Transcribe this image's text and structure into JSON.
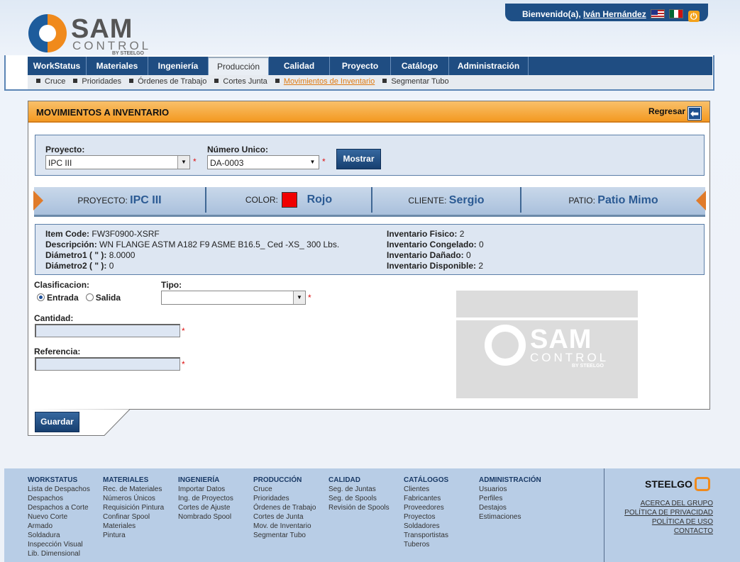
{
  "header": {
    "welcome_prefix": "Bienvenido(a),",
    "user_name": "Iván Hernández",
    "logo": {
      "brand": "SAM",
      "sub": "CONTROL",
      "by": "BY STEELGO"
    },
    "language_icons": [
      "us-flag-icon",
      "mx-flag-icon"
    ],
    "power_icon": "power-icon"
  },
  "nav": {
    "items": [
      "WorkStatus",
      "Materiales",
      "Ingeniería",
      "Producción",
      "Calidad",
      "Proyecto",
      "Catálogo",
      "Administración"
    ],
    "active": "Producción"
  },
  "subnav": {
    "items": [
      "Cruce",
      "Prioridades",
      "Órdenes de Trabajo",
      "Cortes Junta",
      "Movimientos de Inventario",
      "Segmentar Tubo"
    ],
    "active": "Movimientos de Inventario"
  },
  "panel": {
    "title": "MOVIMIENTOS A INVENTARIO",
    "back_label": "Regresar",
    "filters": {
      "proyecto_label": "Proyecto:",
      "proyecto_value": "IPC III",
      "numero_label": "Número Unico:",
      "numero_value": "DA-0003",
      "show_button": "Mostrar"
    },
    "band": {
      "proyecto_label": "PROYECTO:",
      "proyecto_value": "IPC III",
      "color_label": "COLOR:",
      "color_value": "Rojo",
      "color_hex": "#f00000",
      "cliente_label": "CLIENTE:",
      "cliente_value": "Sergio",
      "patio_label": "PATIO:",
      "patio_value": "Patio Mimo"
    },
    "details": {
      "item_code_label": "Item Code:",
      "item_code": "FW3F0900-XSRF",
      "descripcion_label": "Descripción:",
      "descripcion": "WN FLANGE ASTM A182 F9 ASME B16.5_ Ced -XS_ 300 Lbs.",
      "diametro1_label": "Diámetro1 ( \" ):",
      "diametro1": "8.0000",
      "diametro2_label": "Diámetro2 ( \" ):",
      "diametro2": "0",
      "inv_fisico_label": "Inventario Fisico:",
      "inv_fisico": "2",
      "inv_congelado_label": "Inventario Congelado:",
      "inv_congelado": "0",
      "inv_danado_label": "Inventario Dañado:",
      "inv_danado": "0",
      "inv_disponible_label": "Inventario Disponible:",
      "inv_disponible": "2"
    },
    "form": {
      "clasificacion_label": "Clasificacion:",
      "entrada_label": "Entrada",
      "salida_label": "Salida",
      "selected": "Entrada",
      "tipo_label": "Tipo:",
      "tipo_value": "",
      "cantidad_label": "Cantidad:",
      "cantidad_value": "",
      "referencia_label": "Referencia:",
      "referencia_value": "",
      "required_mark": "*"
    },
    "save_button": "Guardar"
  },
  "footer": {
    "columns": [
      {
        "title": "WORKSTATUS",
        "links": [
          "Lista de Despachos",
          "Despachos",
          "Despachos a Corte",
          "Nuevo Corte",
          "Armado",
          "Soldadura",
          "Inspección Visual",
          "Lib. Dimensional"
        ]
      },
      {
        "title": "MATERIALES",
        "links": [
          "Rec. de Materiales",
          "Números Únicos",
          "Requisición Pintura",
          "Confinar Spool",
          "Materiales",
          "Pintura"
        ]
      },
      {
        "title": "INGENIERÍA",
        "links": [
          "Importar Datos",
          "Ing. de Proyectos",
          "Cortes de Ajuste",
          "Nombrado Spool"
        ]
      },
      {
        "title": "PRODUCCIÓN",
        "links": [
          "Cruce",
          "Prioridades",
          "Órdenes de Trabajo",
          "Cortes de Junta",
          "Mov. de Inventario",
          "Segmentar Tubo"
        ]
      },
      {
        "title": "CALIDAD",
        "links": [
          "Seg. de Juntas",
          "Seg. de Spools",
          "Revisión de Spools"
        ]
      },
      {
        "title": "CATÁLOGOS",
        "links": [
          "Clientes",
          "Fabricantes",
          "Proveedores",
          "Proyectos",
          "Soldadores",
          "Transportistas",
          "Tuberos"
        ]
      },
      {
        "title": "ADMINISTRACIÓN",
        "links": [
          "Usuarios",
          "Perfiles",
          "Destajos",
          "Estimaciones"
        ]
      }
    ],
    "brand": "STEELGO",
    "links": [
      "ACERCA DEL GRUPO",
      "POLÍTICA DE PRIVACIDAD",
      "POLÍTICA DE USO",
      "CONTACTO"
    ]
  }
}
